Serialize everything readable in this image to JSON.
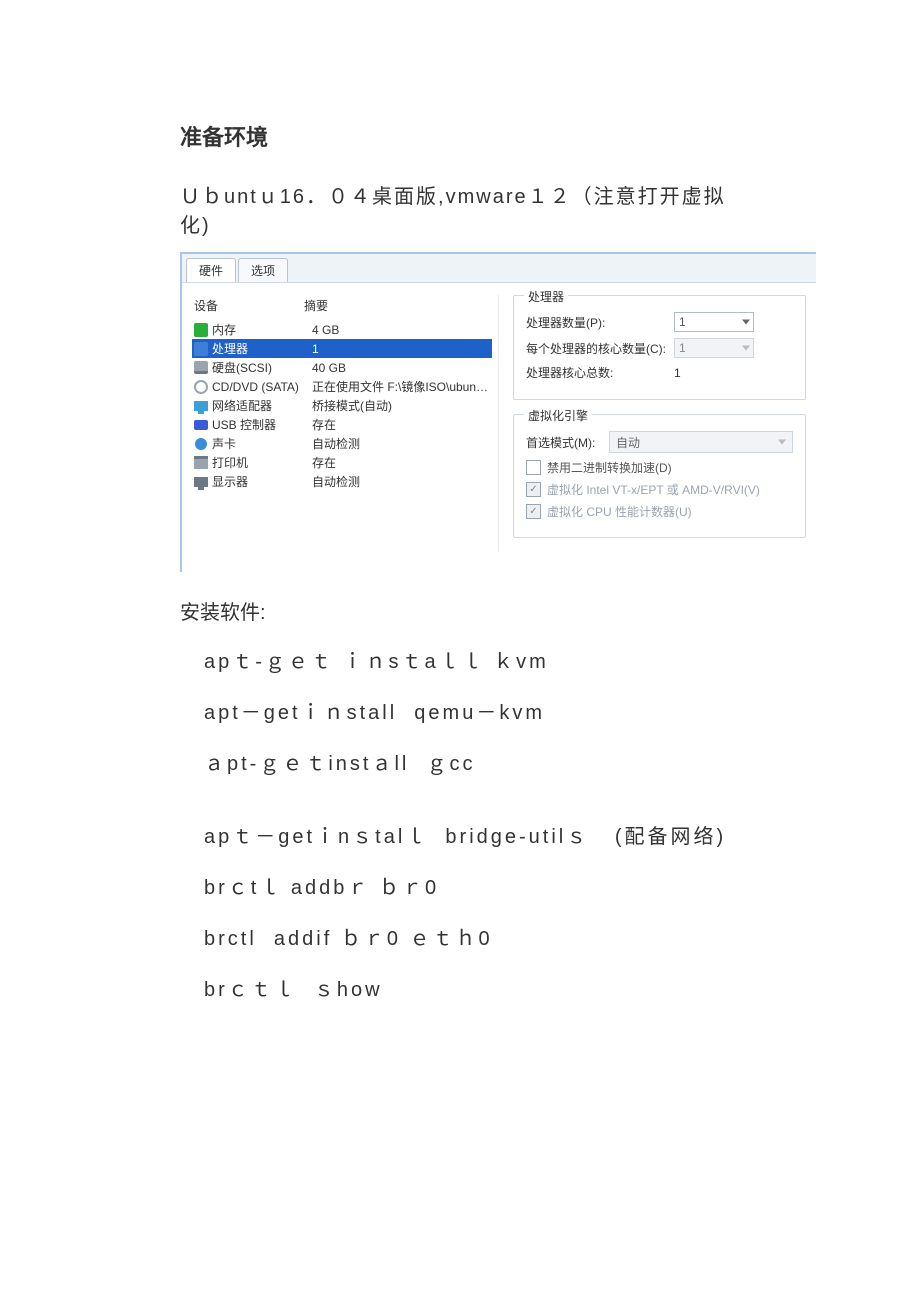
{
  "doc": {
    "heading": "准备环境",
    "intro": "Ｕｂuntｕ16．０４桌面版,vmware１２（注意打开虚拟化)",
    "install_title": "安装软件:",
    "commands": [
      "apｔ-ｇｅｔ ｉｎsｔaｌｌ ｋvm",
      "apt－getｉｎstall  qemu－kvm",
      "ａpt-ｇｅｔinstａll  ｇcc",
      "apｔ－getｉnｓtalｌ  bridge-utilｓ   (配备网络)",
      "brｃtｌ addbｒ ｂｒ0",
      "brctl  addif ｂｒ0 ｅｔｈ0",
      "brｃｔｌ  ｓhow"
    ]
  },
  "vm": {
    "tabs": {
      "hardware": "硬件",
      "options": "选项"
    },
    "cols": {
      "device": "设备",
      "summary": "摘要"
    },
    "devices": [
      {
        "icon": "mem-icon",
        "name": "内存",
        "summary": "4 GB",
        "selected": false
      },
      {
        "icon": "cpu-icon",
        "name": "处理器",
        "summary": "1",
        "selected": true
      },
      {
        "icon": "hdd-icon",
        "name": "硬盘(SCSI)",
        "summary": "40 GB",
        "selected": false
      },
      {
        "icon": "cd-icon",
        "name": "CD/DVD (SATA)",
        "summary": "正在使用文件 F:\\镜像ISO\\ubuntu-1...",
        "selected": false
      },
      {
        "icon": "net-icon",
        "name": "网络适配器",
        "summary": "桥接模式(自动)",
        "selected": false
      },
      {
        "icon": "usb-icon",
        "name": "USB 控制器",
        "summary": "存在",
        "selected": false
      },
      {
        "icon": "snd-icon",
        "name": "声卡",
        "summary": "自动检测",
        "selected": false
      },
      {
        "icon": "prn-icon",
        "name": "打印机",
        "summary": "存在",
        "selected": false
      },
      {
        "icon": "disp-icon",
        "name": "显示器",
        "summary": "自动检测",
        "selected": false
      }
    ],
    "cpu": {
      "group": "处理器",
      "count_label": "处理器数量(P):",
      "count_value": "1",
      "cores_label": "每个处理器的核心数量(C):",
      "cores_value": "1",
      "total_label": "处理器核心总数:",
      "total_value": "1"
    },
    "virt": {
      "group": "虚拟化引擎",
      "mode_label": "首选模式(M):",
      "mode_value": "自动",
      "disable_bin": "禁用二进制转换加速(D)",
      "vtx": "虚拟化 Intel VT-x/EPT 或 AMD-V/RVI(V)",
      "perf": "虚拟化 CPU 性能计数器(U)"
    }
  }
}
